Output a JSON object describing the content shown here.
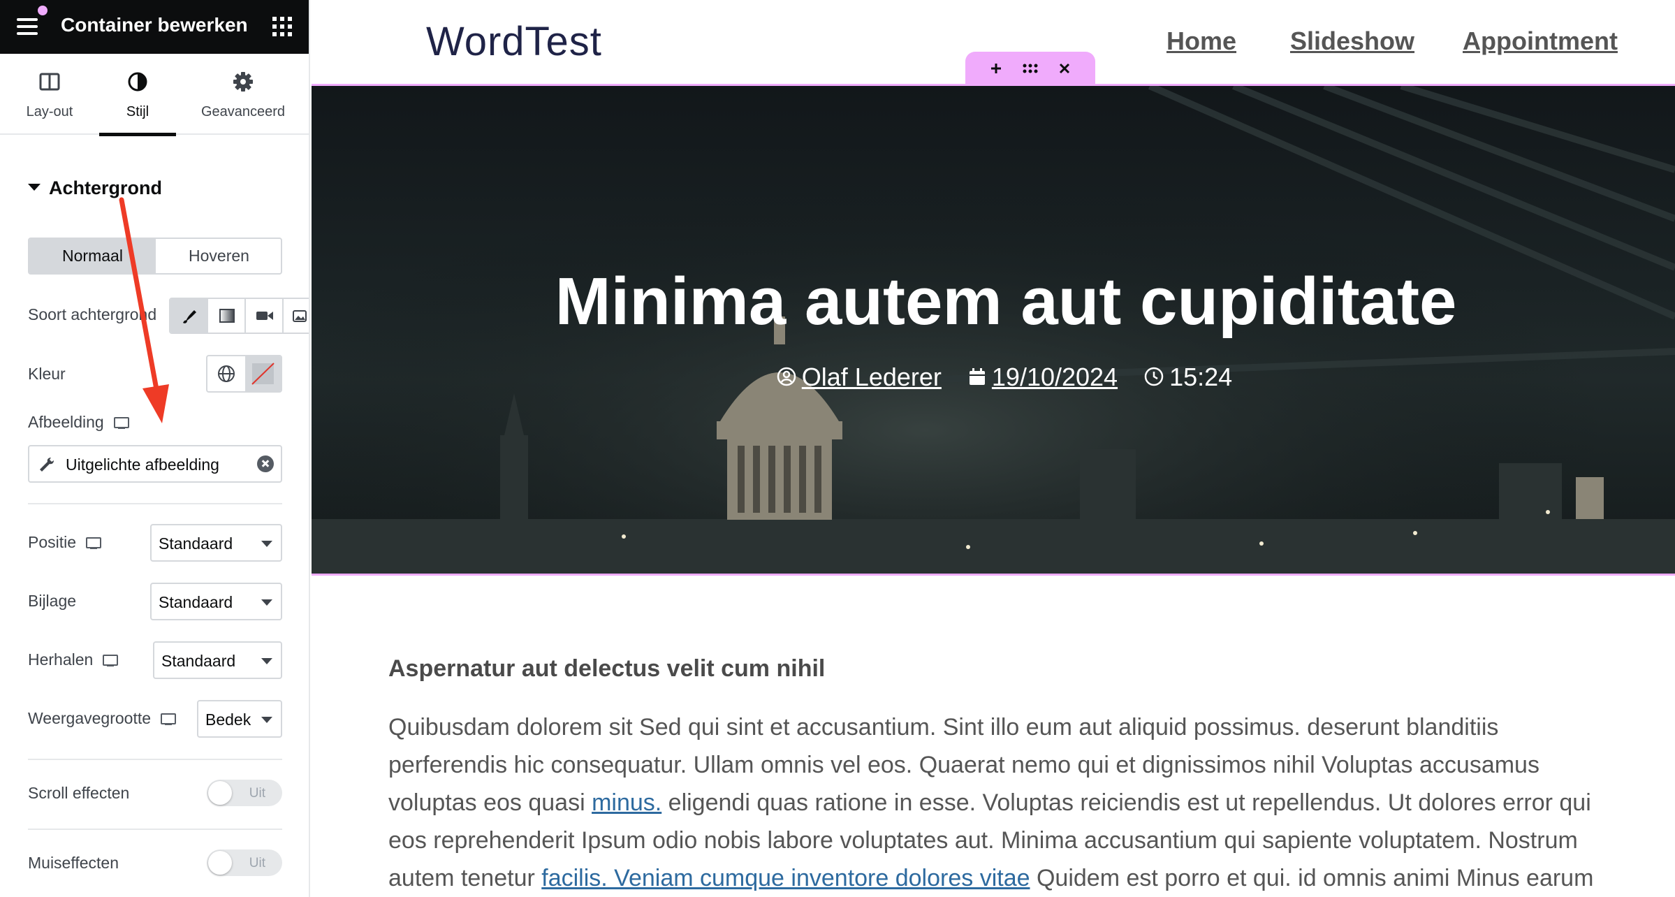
{
  "editor": {
    "title": "Container bewerken",
    "tabs": [
      {
        "label": "Lay-out",
        "icon": "layout-icon"
      },
      {
        "label": "Stijl",
        "icon": "style-icon"
      },
      {
        "label": "Geavanceerd",
        "icon": "gear-icon"
      }
    ],
    "active_tab": "Stijl",
    "section": "Achtergrond",
    "states": [
      "Normaal",
      "Hoveren"
    ],
    "active_state": "Normaal",
    "bg_type_label": "Soort achtergrond",
    "color_label": "Kleur",
    "image_label": "Afbeelding",
    "image_value": "Uitgelichte afbeelding",
    "position": {
      "label": "Positie",
      "value": "Standaard"
    },
    "attachment": {
      "label": "Bijlage",
      "value": "Standaard"
    },
    "repeat": {
      "label": "Herhalen",
      "value": "Standaard"
    },
    "display_size": {
      "label": "Weergavegrootte",
      "value": "Bedek"
    },
    "scroll_effects": {
      "label": "Scroll effecten",
      "state": "Uit"
    },
    "mouse_effects": {
      "label": "Muiseffecten",
      "state": "Uit"
    }
  },
  "site": {
    "logo": "WordTest",
    "nav": [
      "Home",
      "Slideshow",
      "Appointment"
    ]
  },
  "hero": {
    "title": "Minima autem aut cupiditate",
    "author": "Olaf Lederer",
    "date": "19/10/2024",
    "time": "15:24"
  },
  "content": {
    "subtitle": "Aspernatur aut delectus velit cum nihil",
    "line1": "Quibusdam dolorem sit Sed qui sint et accusantium. Sint illo eum aut aliquid possimus. deserunt blanditiis",
    "line2": "perferendis hic consequatur. Ullam omnis vel eos. Quaerat nemo qui et dignissimos nihil Voluptas accusamus",
    "line3_pre": "voluptas eos quasi ",
    "line3_link": "minus.",
    "line3_post": " eligendi quas ratione in esse. Voluptas reiciendis est ut repellendus. Ut dolores error qui",
    "line4": "eos reprehenderit Ipsum odio nobis labore voluptates aut. Minima accusantium qui sapiente voluptatem. Nostrum",
    "line5_pre": "autem tenetur ",
    "line5_link": "facilis. Veniam cumque inventore dolores vitae",
    "line5_post": " Quidem est porro et qui. id omnis animi Minus earum"
  },
  "colors": {
    "accent": "#f0abfc",
    "annotation_arrow": "#ee3b26",
    "link": "#2d6a9f",
    "header_bg": "#0c0d0e"
  }
}
